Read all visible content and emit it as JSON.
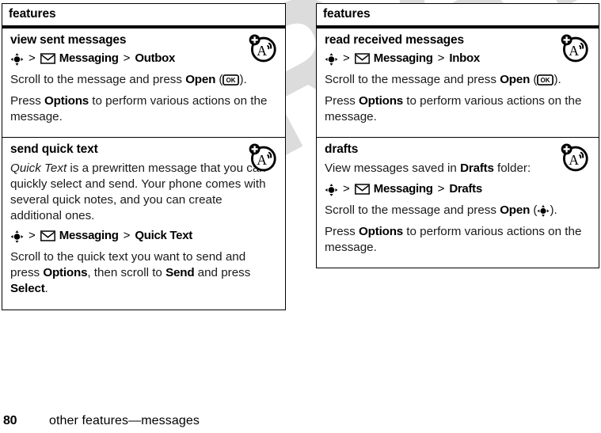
{
  "page": {
    "number": "80",
    "running_title": "other features—messages",
    "watermark": "DRAFT"
  },
  "icons": {
    "nav_key": "navigation-key-icon",
    "envelope": "envelope-icon",
    "ok_key": "ok-key-icon",
    "ok_key_label": "OK",
    "corner": "text-entry-mode-icon"
  },
  "columns": [
    {
      "header": "features",
      "sections": [
        {
          "title": "view sent messages",
          "has_corner_icon": true,
          "blocks": [
            {
              "type": "path",
              "parts": [
                {
                  "kind": "navkey"
                },
                {
                  "kind": "sep",
                  "text": ">"
                },
                {
                  "kind": "envelope"
                },
                {
                  "kind": "word",
                  "text": "Messaging"
                },
                {
                  "kind": "sep",
                  "text": ">"
                },
                {
                  "kind": "word",
                  "text": "Outbox"
                }
              ]
            },
            {
              "type": "para",
              "runs": [
                {
                  "style": "normal",
                  "text": "Scroll to the message and press "
                },
                {
                  "style": "bold",
                  "text": "Open"
                },
                {
                  "style": "normal",
                  "text": " ("
                },
                {
                  "style": "okkey"
                },
                {
                  "style": "normal",
                  "text": ")."
                }
              ]
            },
            {
              "type": "para",
              "runs": [
                {
                  "style": "normal",
                  "text": "Press "
                },
                {
                  "style": "bold",
                  "text": "Options"
                },
                {
                  "style": "normal",
                  "text": " to perform various actions on the message."
                }
              ]
            }
          ]
        },
        {
          "title": "send quick text",
          "has_corner_icon": true,
          "blocks": [
            {
              "type": "para",
              "runs": [
                {
                  "style": "italic",
                  "text": "Quick Text"
                },
                {
                  "style": "normal",
                  "text": " is a prewritten message that you can quickly select and send. Your phone comes with several quick notes, and you can create additional ones."
                }
              ]
            },
            {
              "type": "path",
              "parts": [
                {
                  "kind": "navkey"
                },
                {
                  "kind": "sep",
                  "text": ">"
                },
                {
                  "kind": "envelope"
                },
                {
                  "kind": "word",
                  "text": "Messaging"
                },
                {
                  "kind": "sep",
                  "text": ">"
                },
                {
                  "kind": "word",
                  "text": "Quick Text"
                }
              ]
            },
            {
              "type": "para",
              "runs": [
                {
                  "style": "normal",
                  "text": "Scroll to the quick text you want to send and press "
                },
                {
                  "style": "bold",
                  "text": "Options"
                },
                {
                  "style": "normal",
                  "text": ", then scroll to "
                },
                {
                  "style": "bold",
                  "text": "Send"
                },
                {
                  "style": "normal",
                  "text": " and press "
                },
                {
                  "style": "bold",
                  "text": "Select"
                },
                {
                  "style": "normal",
                  "text": "."
                }
              ]
            }
          ]
        }
      ]
    },
    {
      "header": "features",
      "sections": [
        {
          "title": "read received messages",
          "has_corner_icon": true,
          "blocks": [
            {
              "type": "path",
              "parts": [
                {
                  "kind": "navkey"
                },
                {
                  "kind": "sep",
                  "text": ">"
                },
                {
                  "kind": "envelope"
                },
                {
                  "kind": "word",
                  "text": "Messaging"
                },
                {
                  "kind": "sep",
                  "text": ">"
                },
                {
                  "kind": "word",
                  "text": "Inbox"
                }
              ]
            },
            {
              "type": "para",
              "runs": [
                {
                  "style": "normal",
                  "text": "Scroll to the message and press "
                },
                {
                  "style": "bold",
                  "text": "Open"
                },
                {
                  "style": "normal",
                  "text": " ("
                },
                {
                  "style": "okkey"
                },
                {
                  "style": "normal",
                  "text": ")."
                }
              ]
            },
            {
              "type": "para",
              "runs": [
                {
                  "style": "normal",
                  "text": "Press "
                },
                {
                  "style": "bold",
                  "text": "Options"
                },
                {
                  "style": "normal",
                  "text": " to perform various actions on the message."
                }
              ]
            }
          ]
        },
        {
          "title": "drafts",
          "has_corner_icon": true,
          "blocks": [
            {
              "type": "para",
              "runs": [
                {
                  "style": "normal",
                  "text": "View messages saved in "
                },
                {
                  "style": "bold",
                  "text": "Drafts"
                },
                {
                  "style": "normal",
                  "text": " folder:"
                }
              ]
            },
            {
              "type": "path",
              "parts": [
                {
                  "kind": "navkey"
                },
                {
                  "kind": "sep",
                  "text": ">"
                },
                {
                  "kind": "envelope"
                },
                {
                  "kind": "word",
                  "text": "Messaging"
                },
                {
                  "kind": "sep",
                  "text": ">"
                },
                {
                  "kind": "word",
                  "text": "Drafts"
                }
              ]
            },
            {
              "type": "para",
              "runs": [
                {
                  "style": "normal",
                  "text": "Scroll to the message and press "
                },
                {
                  "style": "bold",
                  "text": "Open"
                },
                {
                  "style": "normal",
                  "text": " ("
                },
                {
                  "style": "navkey"
                },
                {
                  "style": "normal",
                  "text": ")."
                }
              ]
            },
            {
              "type": "para",
              "runs": [
                {
                  "style": "normal",
                  "text": "Press "
                },
                {
                  "style": "bold",
                  "text": "Options"
                },
                {
                  "style": "normal",
                  "text": " to perform various actions on the message."
                }
              ]
            }
          ]
        }
      ]
    }
  ]
}
